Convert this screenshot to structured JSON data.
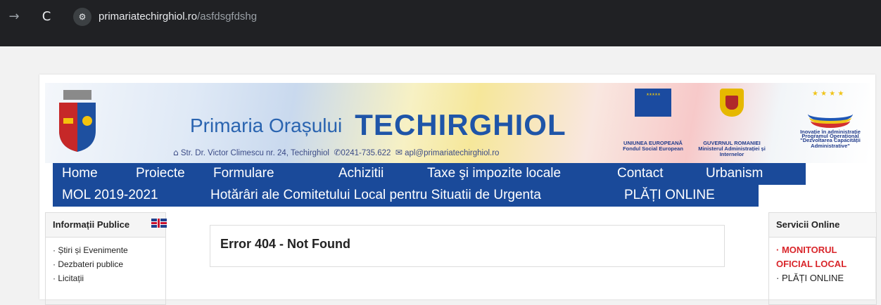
{
  "browser": {
    "back_glyph": "→",
    "reload_glyph": "C",
    "site_info_glyph": "⚙",
    "url_host": "primariatechirghiol.ro",
    "url_path": "/asfdsgfdshg"
  },
  "header": {
    "title_small": "Primaria Orașului",
    "title_big": "TECHIRGHIOL",
    "home_sym": "⌂",
    "address": "Str. Dr. Victor Climescu nr. 24, Techirghiol",
    "phone_sym": "✆",
    "phone": "0241-735.622",
    "mail_sym": "✉",
    "email": "apl@primariatechirghiol.ro",
    "eu_stars": "* * * * *",
    "eu_caption_1": "UNIUNEA EUROPEANĂ",
    "eu_caption_2": "Fondul Social European",
    "gov_caption_1": "GUVERNUL ROMANIEI",
    "gov_caption_2": "Ministerul Administrației și Internelor",
    "po_caption_1": "Inovație în administrație",
    "po_caption_2": "Programul Operațional",
    "po_caption_3": "\"Dezvoltarea Capacității Administrative\"",
    "po_stars": "★ ★ ★ ★"
  },
  "nav": {
    "row1": [
      "Home",
      "Proiecte",
      "Formulare",
      "Achizitii",
      "Taxe şi impozite locale",
      "Contact",
      "Urbanism"
    ],
    "row2": [
      "MOL 2019-2021",
      "Hotărâri ale Comitetului Local pentru Situatii de Urgenta",
      "PLĂȚI ONLINE"
    ]
  },
  "left_sidebar": {
    "title": "Informații Publice",
    "items": [
      "Știri și Evenimente",
      "Dezbateri publice",
      "Licitații"
    ]
  },
  "main": {
    "error_title": "Error 404 - Not Found"
  },
  "right_sidebar": {
    "title": "Servicii Online",
    "items": [
      "MONITORUL OFICIAL LOCAL",
      "PLĂȚI ONLINE"
    ]
  },
  "colors": {
    "nav_bg": "#1a4a9a",
    "title_blue": "#1f55a8",
    "highlight_red": "#d9262b"
  }
}
